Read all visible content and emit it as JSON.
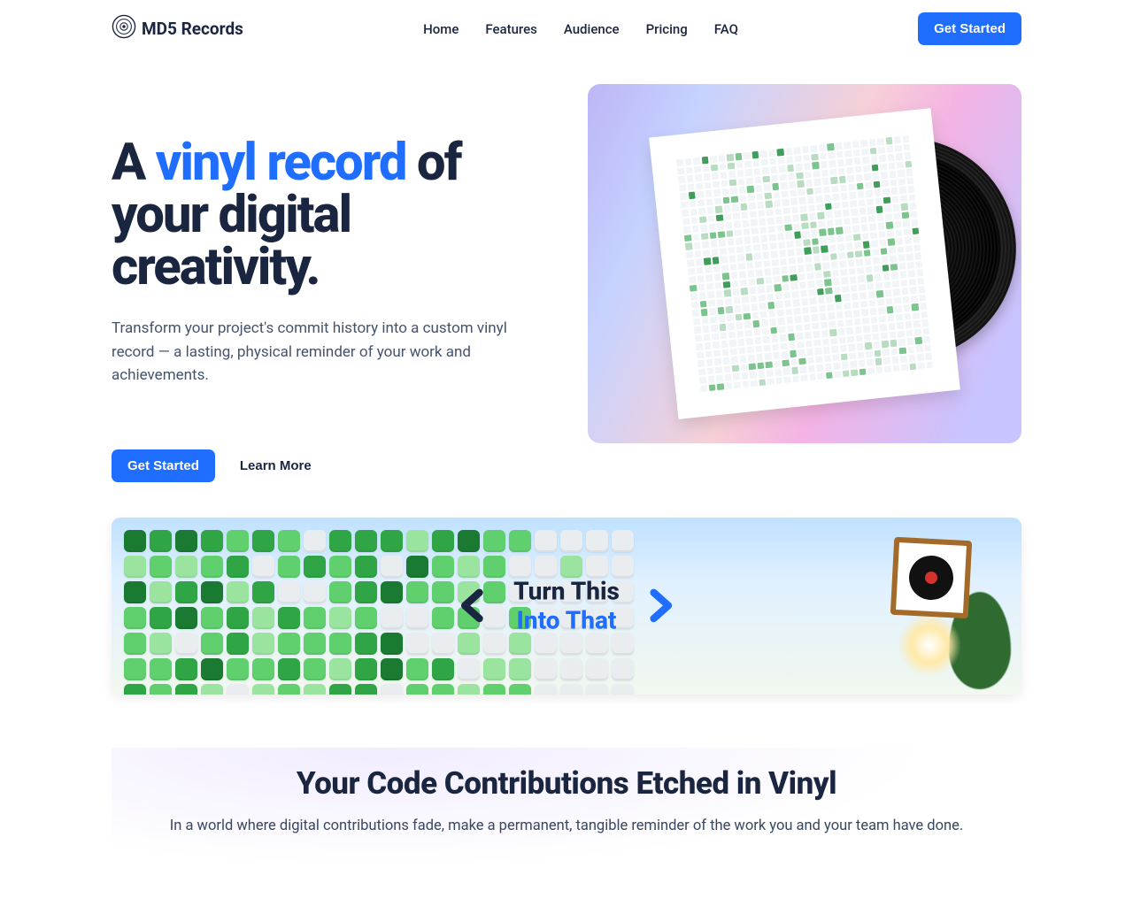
{
  "brand": {
    "name": "MD5 Records"
  },
  "nav": {
    "links": [
      "Home",
      "Features",
      "Audience",
      "Pricing",
      "FAQ"
    ],
    "cta": "Get Started"
  },
  "hero": {
    "title_pre": "A ",
    "title_accent": "vinyl record",
    "title_post": " of your digital creativity.",
    "lead": "Transform your project's commit history into a custom vinyl record — a lasting, physical reminder of your work and achievements.",
    "primary_cta": "Get Started",
    "secondary_cta": "Learn More"
  },
  "banner": {
    "line1": "Turn This",
    "line2": "Into That"
  },
  "features": {
    "heading": "Your Code Contributions Etched in Vinyl",
    "sub": "In a world where digital contributions fade, make a permanent, tangible reminder of the work you and your team have done."
  }
}
